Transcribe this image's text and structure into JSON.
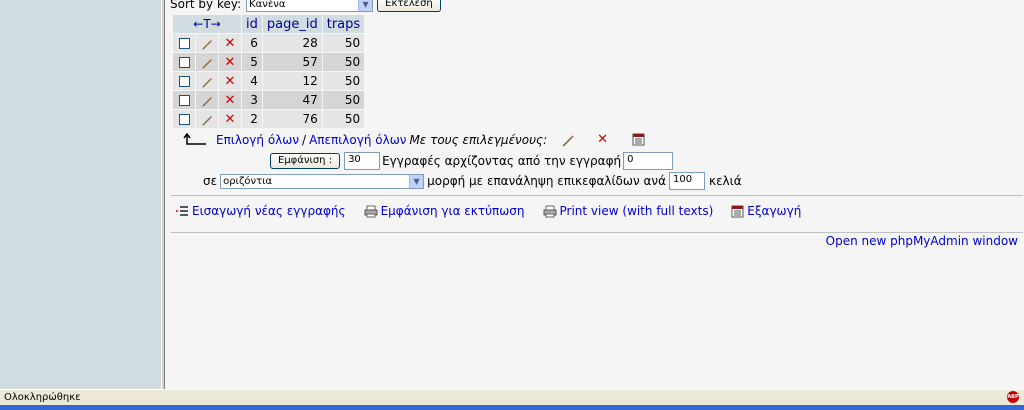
{
  "sort": {
    "label": "Sort by key:",
    "value": "Κανένα",
    "button": "Εκτέλεση"
  },
  "table": {
    "arrows": "←T→",
    "headers": [
      "id",
      "page_id",
      "traps"
    ],
    "rows": [
      {
        "id": "6",
        "page_id": "28",
        "traps": "50"
      },
      {
        "id": "5",
        "page_id": "57",
        "traps": "50"
      },
      {
        "id": "4",
        "page_id": "12",
        "traps": "50"
      },
      {
        "id": "3",
        "page_id": "47",
        "traps": "50"
      },
      {
        "id": "2",
        "page_id": "76",
        "traps": "50"
      }
    ]
  },
  "selection": {
    "select_all": "Επιλογή όλων",
    "separator": "/",
    "deselect_all": "Απεπιλογή όλων",
    "with_selected": "Με τους επιλεγμένους:"
  },
  "show": {
    "button": "Εμφάνιση :",
    "rows": "30",
    "text": "Εγγραφές αρχίζοντας από την εγγραφή",
    "start": "0"
  },
  "mode": {
    "prefix": "σε",
    "value": "οριζόντια",
    "text": "μορφή με επανάληψη επικεφαλίδων ανά",
    "repeat": "100",
    "suffix": "κελιά"
  },
  "links": {
    "insert": "Εισαγωγή νέας εγγραφής",
    "print": "Εμφάνιση για εκτύπωση",
    "print_full": "Print view (with full texts)",
    "export": "Εξαγωγή"
  },
  "new_window": "Open new phpMyAdmin window",
  "status": {
    "text": "Ολοκληρώθηκε",
    "badge": "ABP"
  },
  "colors": {
    "link": "#0000cc",
    "header_bg": "#d0dce0",
    "delete": "#cc0000"
  }
}
